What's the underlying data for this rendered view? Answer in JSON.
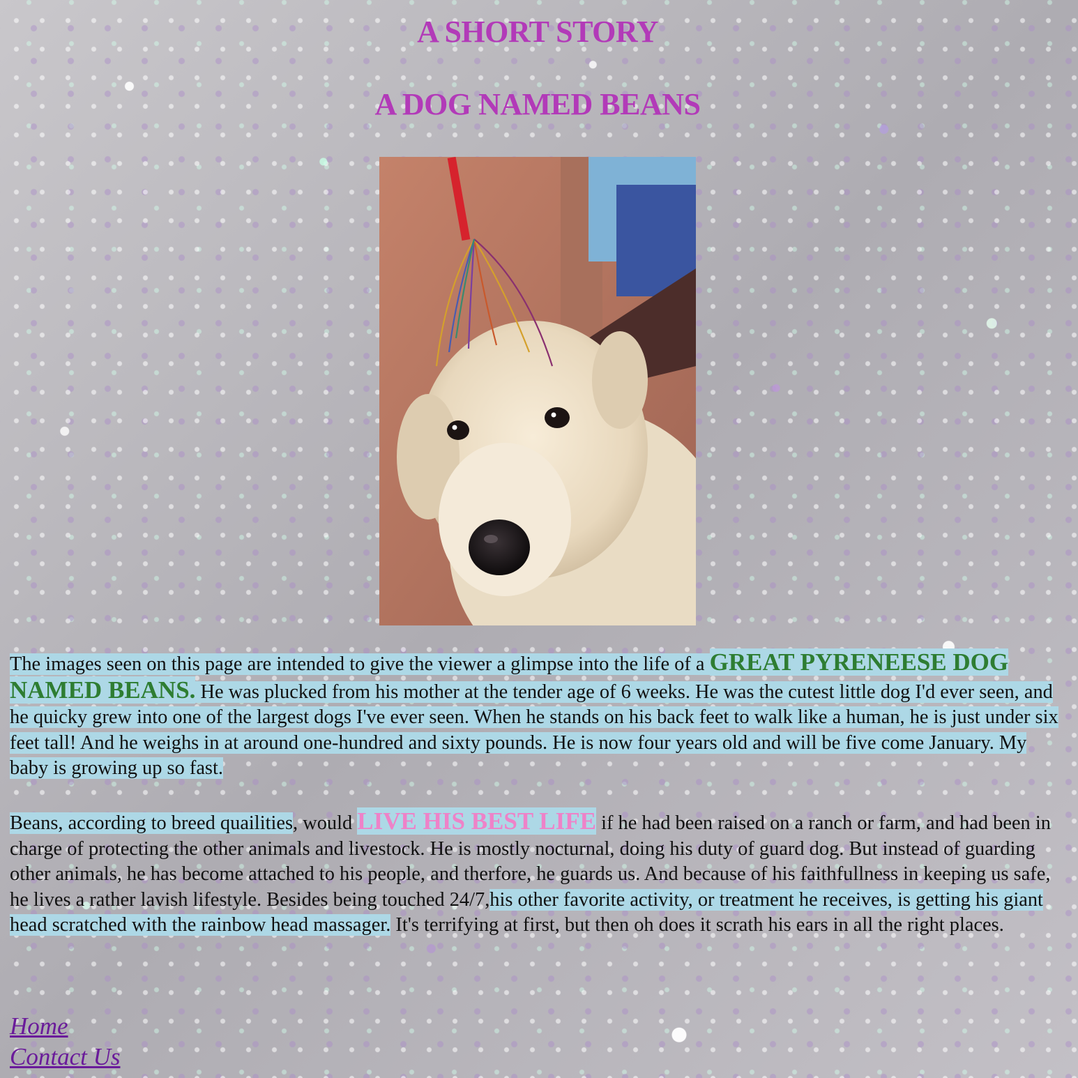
{
  "header": {
    "title": "A SHORT STORY",
    "subtitle": "A DOG NAMED BEANS"
  },
  "photo": {
    "subject": "white Great Pyrenees dog with a rainbow head massager"
  },
  "story": {
    "p1": {
      "intro": "The images seen on this page are intended to give the viewer a glimpse into the life of a ",
      "highlight": "GREAT PYRENEESE DOG NAMED BEANS.",
      "rest": " He was plucked from his mother at the tender age of 6 weeks. He was the cutest little dog I'd ever seen, and he quicky grew into one of the largest dogs I've ever seen. When he stands on his back feet to walk like a human, he is just under six feet tall! And he weighs in at around one-hundred and sixty pounds. He is now four years old and will be five come January. My baby is growing up so fast."
    },
    "p2": {
      "start": "Beans, according to breed quailities",
      "after_start": ", would ",
      "highlight": "LIVE HIS BEST LIFE",
      "middle": " if he had been raised on a ranch or farm, and had been in charge of protecting the other animals and livestock. He is mostly nocturnal, doing his duty of guard dog. But instead of guarding other animals, he has become attached to his people, and therfore, he guards us. And because of his faithfullness in keeping us safe, he lives a rather lavish lifestyle. Besides being touched 24/7,",
      "highlight2": "his other favorite activity, or treatment he receives, is getting his giant head scratched with the rainbow head massager.",
      "end": " It's terrifying at first, but then oh does it scrath his ears in all the right places."
    }
  },
  "nav": {
    "home": "Home",
    "contact": "Contact Us"
  },
  "colors": {
    "title": "#b23ab8",
    "highlight_bg": "#add8e6",
    "green_text": "#2e7d32",
    "pink_text": "#ee82c8",
    "link": "#6a1b9a"
  }
}
